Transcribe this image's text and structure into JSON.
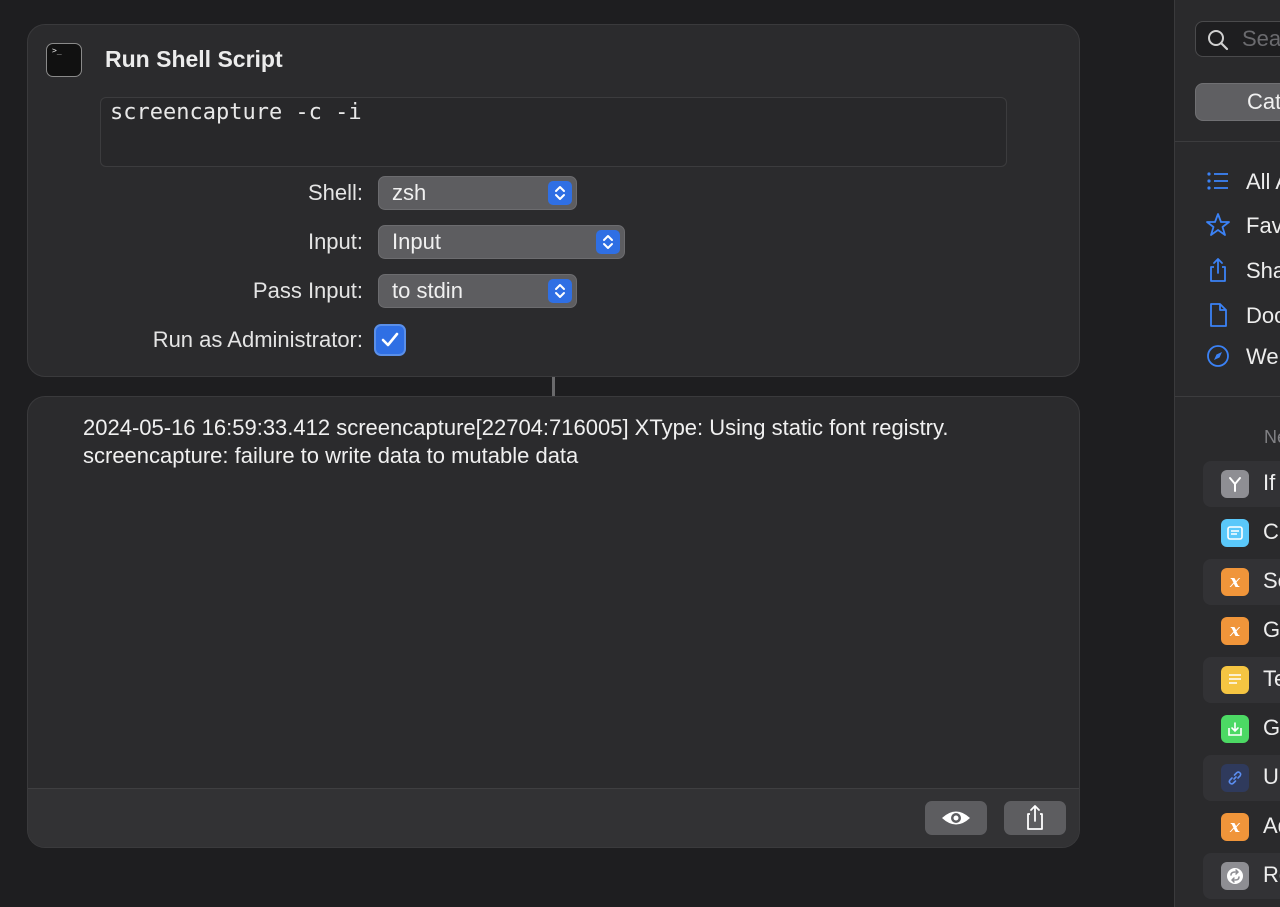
{
  "action": {
    "title": "Run Shell Script",
    "script": "screencapture -c -i",
    "shell_label": "Shell:",
    "shell_value": "zsh",
    "input_label": "Input:",
    "input_value": "Input",
    "pass_input_label": "Pass Input:",
    "pass_input_value": "to stdin",
    "admin_label": "Run as Administrator:",
    "admin_checked": true
  },
  "output": {
    "lines": [
      "2024-05-16 16:59:33.412 screencapture[22704:716005] XType: Using static font registry.",
      "screencapture: failure to write data to mutable data"
    ],
    "buttons": [
      "eye-icon",
      "share-icon"
    ]
  },
  "library": {
    "search_placeholder": "Sea",
    "segment_label": "Cat",
    "nav_items": [
      {
        "label": "All A",
        "icon": "list-icon"
      },
      {
        "label": "Fav",
        "icon": "star-icon"
      },
      {
        "label": "Sha",
        "icon": "share-icon"
      },
      {
        "label": "Doc",
        "icon": "document-icon"
      },
      {
        "label": "We",
        "icon": "compass-icon"
      }
    ],
    "section_header": "Ne",
    "actions": [
      {
        "label": "If",
        "icon": "if-icon",
        "color": "#8e8e93"
      },
      {
        "label": "C",
        "icon": "comment-icon",
        "color": "#5ac8fa"
      },
      {
        "label": "Se",
        "icon": "variable-icon",
        "color": "#f0953a"
      },
      {
        "label": "G",
        "icon": "variable-icon",
        "color": "#f0953a"
      },
      {
        "label": "Te",
        "icon": "text-icon",
        "color": "#f5c542"
      },
      {
        "label": "G",
        "icon": "download-icon",
        "color": "#4cd964"
      },
      {
        "label": "U",
        "icon": "link-icon",
        "color": "#2f3a5c"
      },
      {
        "label": "Ad",
        "icon": "variable-icon",
        "color": "#f0953a"
      },
      {
        "label": "Re",
        "icon": "repeat-icon",
        "color": "#8e8e93"
      }
    ]
  }
}
